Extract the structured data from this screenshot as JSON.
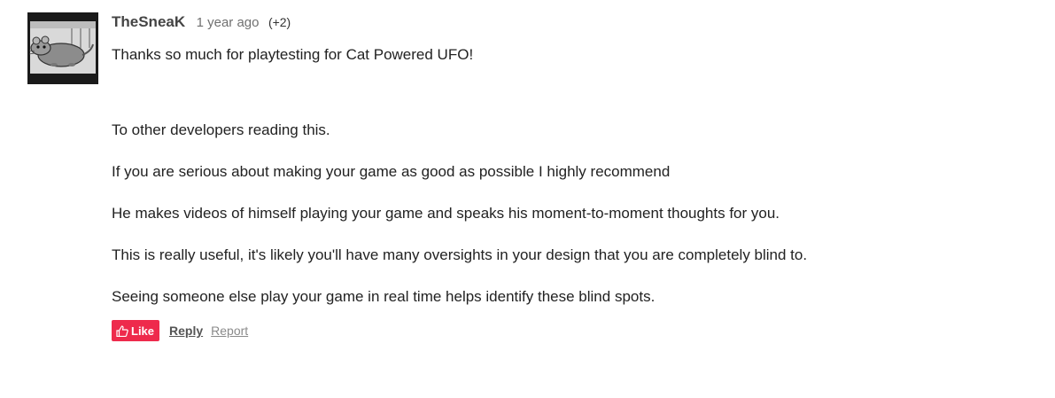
{
  "comment": {
    "author": "TheSneaK",
    "time": "1 year ago",
    "score": "(+2)",
    "avatar_icon": "rat-avatar-icon",
    "paragraphs": [
      "Thanks so much for playtesting for Cat Powered UFO!",
      "To other developers reading this.",
      "If you are serious about making your game as good as possible I highly recommend",
      "He makes videos of himself playing your game and speaks his moment-to-moment thoughts for you.",
      "This is really useful, it's likely you'll have many oversights in your design that you are completely blind to.",
      "Seeing someone else play your game in real time helps identify these blind spots."
    ],
    "actions": {
      "like_label": "Like",
      "like_icon": "thumbs-up-icon",
      "reply_label": "Reply",
      "report_label": "Report"
    }
  },
  "colors": {
    "like_button": "#ee2a4c",
    "author": "#444444",
    "text": "#222222"
  }
}
